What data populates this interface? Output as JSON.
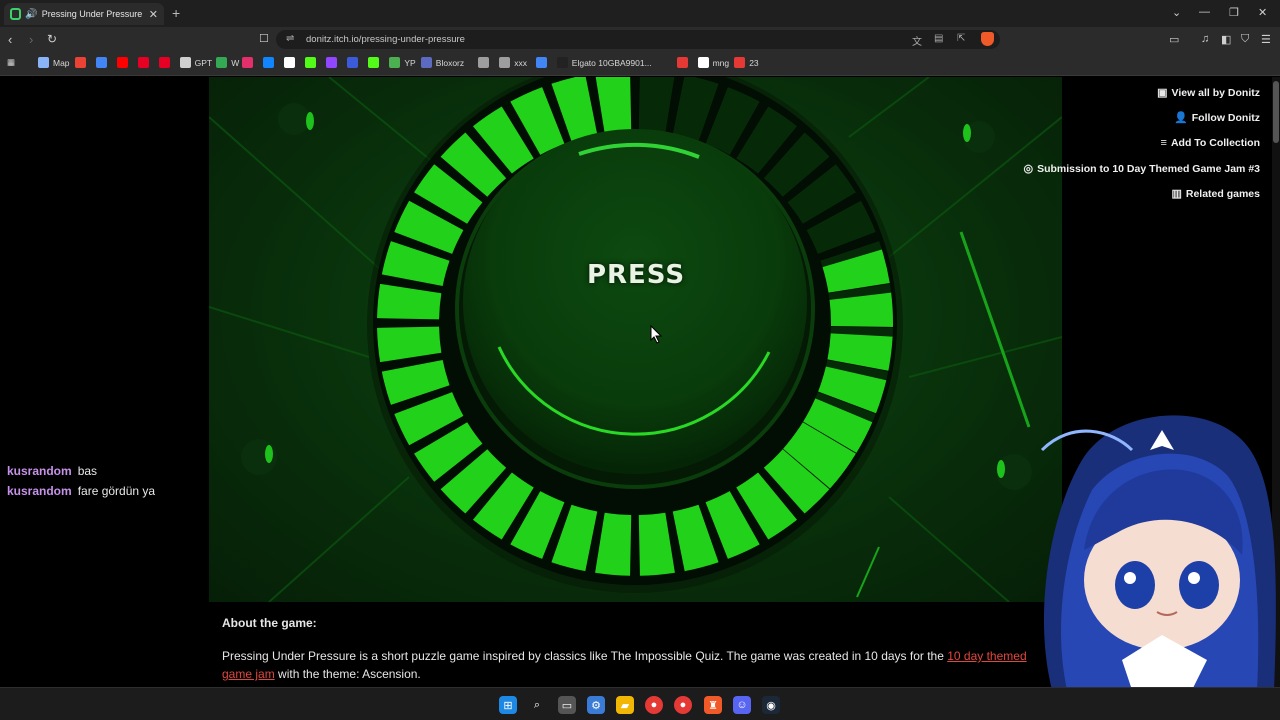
{
  "browser": {
    "tab_title": "Pressing Under Pressure by D",
    "url": "donitz.itch.io/pressing-under-pressure",
    "bookmarks": [
      {
        "label": "Map",
        "color": "#8ab4f8"
      },
      {
        "label": "",
        "color": "#ea4335"
      },
      {
        "label": "",
        "color": "#4285f4"
      },
      {
        "label": "",
        "color": "#ff0000"
      },
      {
        "label": "",
        "color": "#e60023"
      },
      {
        "label": "",
        "color": "#e60023"
      },
      {
        "label": "GPT",
        "color": "#cfcfcf"
      },
      {
        "label": "W",
        "color": "#34a853"
      },
      {
        "label": "",
        "color": "#e1306c"
      },
      {
        "label": "",
        "color": "#1185fe"
      },
      {
        "label": "",
        "color": "#ffffff"
      },
      {
        "label": "",
        "color": "#53fc18"
      },
      {
        "label": "",
        "color": "#9146ff"
      },
      {
        "label": "",
        "color": "#3b5bdb"
      },
      {
        "label": "",
        "color": "#53fc18"
      },
      {
        "label": "YP",
        "color": "#4caf50"
      },
      {
        "label": "Bloxorz",
        "color": "#5c6bc0"
      },
      {
        "label": "",
        "color": "#9e9e9e"
      },
      {
        "label": "xxx",
        "color": "#9e9e9e"
      },
      {
        "label": "",
        "color": "#4285f4"
      },
      {
        "label": "Elgato 10GBA9901...",
        "color": "#222222"
      },
      {
        "label": "",
        "color": "#e53935"
      },
      {
        "label": "mng",
        "color": "#ffffff"
      },
      {
        "label": "23",
        "color": "#e53935"
      }
    ]
  },
  "game": {
    "press_label": "PRESS",
    "segments_total": 36,
    "segments_lit": 24
  },
  "sidebar_actions": {
    "view_all": "View all by Donitz",
    "follow": "Follow Donitz",
    "add_collection": "Add To Collection",
    "submission": "Submission to 10 Day Themed Game Jam #3",
    "related": "Related games"
  },
  "about": {
    "heading": "About the game:",
    "text_before": "Pressing Under Pressure is a short puzzle game inspired by classics like The Impossible Quiz. The game was created in 10 days for the ",
    "link": "10 day themed game jam",
    "text_after": " with the theme: Ascension."
  },
  "chat": [
    {
      "user": "kusrandom",
      "message": "bas"
    },
    {
      "user": "kusrandom",
      "message": "fare gördün ya"
    }
  ],
  "colors": {
    "segment_lit": "#22d11a",
    "segment_dark": "#062a07",
    "link": "#e0483e",
    "chat_user": "#c792ea"
  }
}
